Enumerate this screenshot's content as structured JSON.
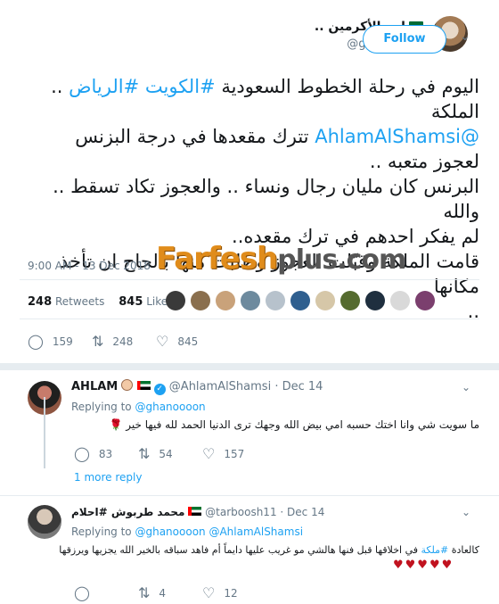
{
  "main_tweet": {
    "display_name": "ابن الأكرمين ..",
    "handle": "@ghanoooon",
    "follow_label": "Follow",
    "text_lines": [
      {
        "parts": [
          {
            "t": "اليوم في رحلة الخطوط السعودية ",
            "k": "text"
          },
          {
            "t": "#الكويت",
            "k": "hashtag"
          },
          {
            "t": " ",
            "k": "text"
          },
          {
            "t": "#الرياض",
            "k": "hashtag"
          },
          {
            "t": " .. الملكة",
            "k": "text"
          }
        ]
      },
      {
        "parts": [
          {
            "t": "@AhlamAlShamsi",
            "k": "mention"
          },
          {
            "t": "  تترك مقعدها في درجة البزنس",
            "k": "text"
          }
        ]
      },
      {
        "parts": [
          {
            "t": "لعجوز متعبه ..",
            "k": "text"
          }
        ]
      },
      {
        "parts": [
          {
            "t": "البرنس كان مليان رجال ونساء .. والعجوز تكاد تسقط .. والله",
            "k": "text"
          }
        ]
      },
      {
        "parts": [
          {
            "t": "لم يفكر احدهم في ترك مقعده..",
            "k": "text"
          }
        ]
      },
      {
        "parts": [
          {
            "t": "قامت الملكة وقبّلت العجوز وطلبت منها بالحاح ان تأخذ مكانها",
            "k": "text"
          }
        ]
      },
      {
        "parts": [
          {
            "t": "..",
            "k": "text"
          }
        ]
      }
    ],
    "timestamp": "9:00 AM - 13 Dec 2018",
    "watermark_text": "Farfesh",
    "watermark_suffix": "plus.com",
    "retweets_count": "248",
    "retweets_label": "Retweets",
    "likes_count": "845",
    "likes_label": "Likes",
    "likers_colors": [
      "#3a3a3a",
      "#8a6f4e",
      "#c9a27a",
      "#6d8a9e",
      "#b7c2cc",
      "#2f5f8f",
      "#d6c7a8",
      "#556b2f",
      "#1f2f3f",
      "#d9d9d9",
      "#7b3f6e"
    ],
    "actions": {
      "reply_count": "159",
      "retweet_count": "248",
      "like_count": "845"
    }
  },
  "reply_1": {
    "display_name": "AHLAM",
    "handle": "@AhlamAlShamsi",
    "date": "· Dec 14",
    "replying_label": "Replying to",
    "replying_to": "@ghanoooon",
    "text": "ما سويت شي وانا اختك حسبه امي بيض الله وجهك ترى الدنيا الحمد لله فيها خير",
    "rose_glyph": "🌹",
    "reply_count": "83",
    "retweet_count": "54",
    "like_count": "157",
    "more_replies": "1 more reply"
  },
  "reply_2": {
    "display_name": "محمد طربوش #احلام",
    "handle": "@tarboosh11",
    "date": "· Dec 14",
    "replying_label": "Replying to",
    "replying_to": "@ghanoooon @AhlamAlShamsi",
    "text_prefix": "كالعادة ",
    "text_hashtag": "#ملكة",
    "text_rest": " في اخلاقها قبل فنها هالشي مو غريب عليها دايماً أم فاهد سباقه بالخير الله يجزيها ويرزقها",
    "hearts": "♥♥♥♥♥",
    "retweet_count": "4",
    "like_count": "12"
  },
  "icons": {
    "reply": "reply-icon",
    "retweet": "retweet-icon",
    "like": "heart-icon",
    "chevron": "chevron-down-icon"
  }
}
